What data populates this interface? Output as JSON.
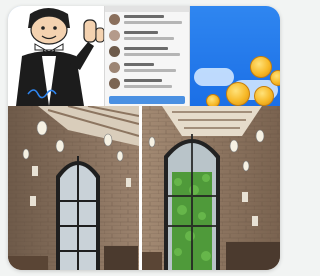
{
  "card": {
    "banner": {
      "cartoon_icon": "cartoon-man-thumbs-up",
      "chat_screenshot_icon": "chat-app-screenshot",
      "coins_icon": "gold-coins",
      "colors": {
        "sky": "#2f86f0",
        "coin": "#f7b928"
      }
    },
    "photo": {
      "scene_icon": "restaurant-interior-photo",
      "colors": {
        "brick": "#8a725f",
        "greenery": "#4f9a3a",
        "window_frame": "#2b2b2b"
      }
    }
  }
}
